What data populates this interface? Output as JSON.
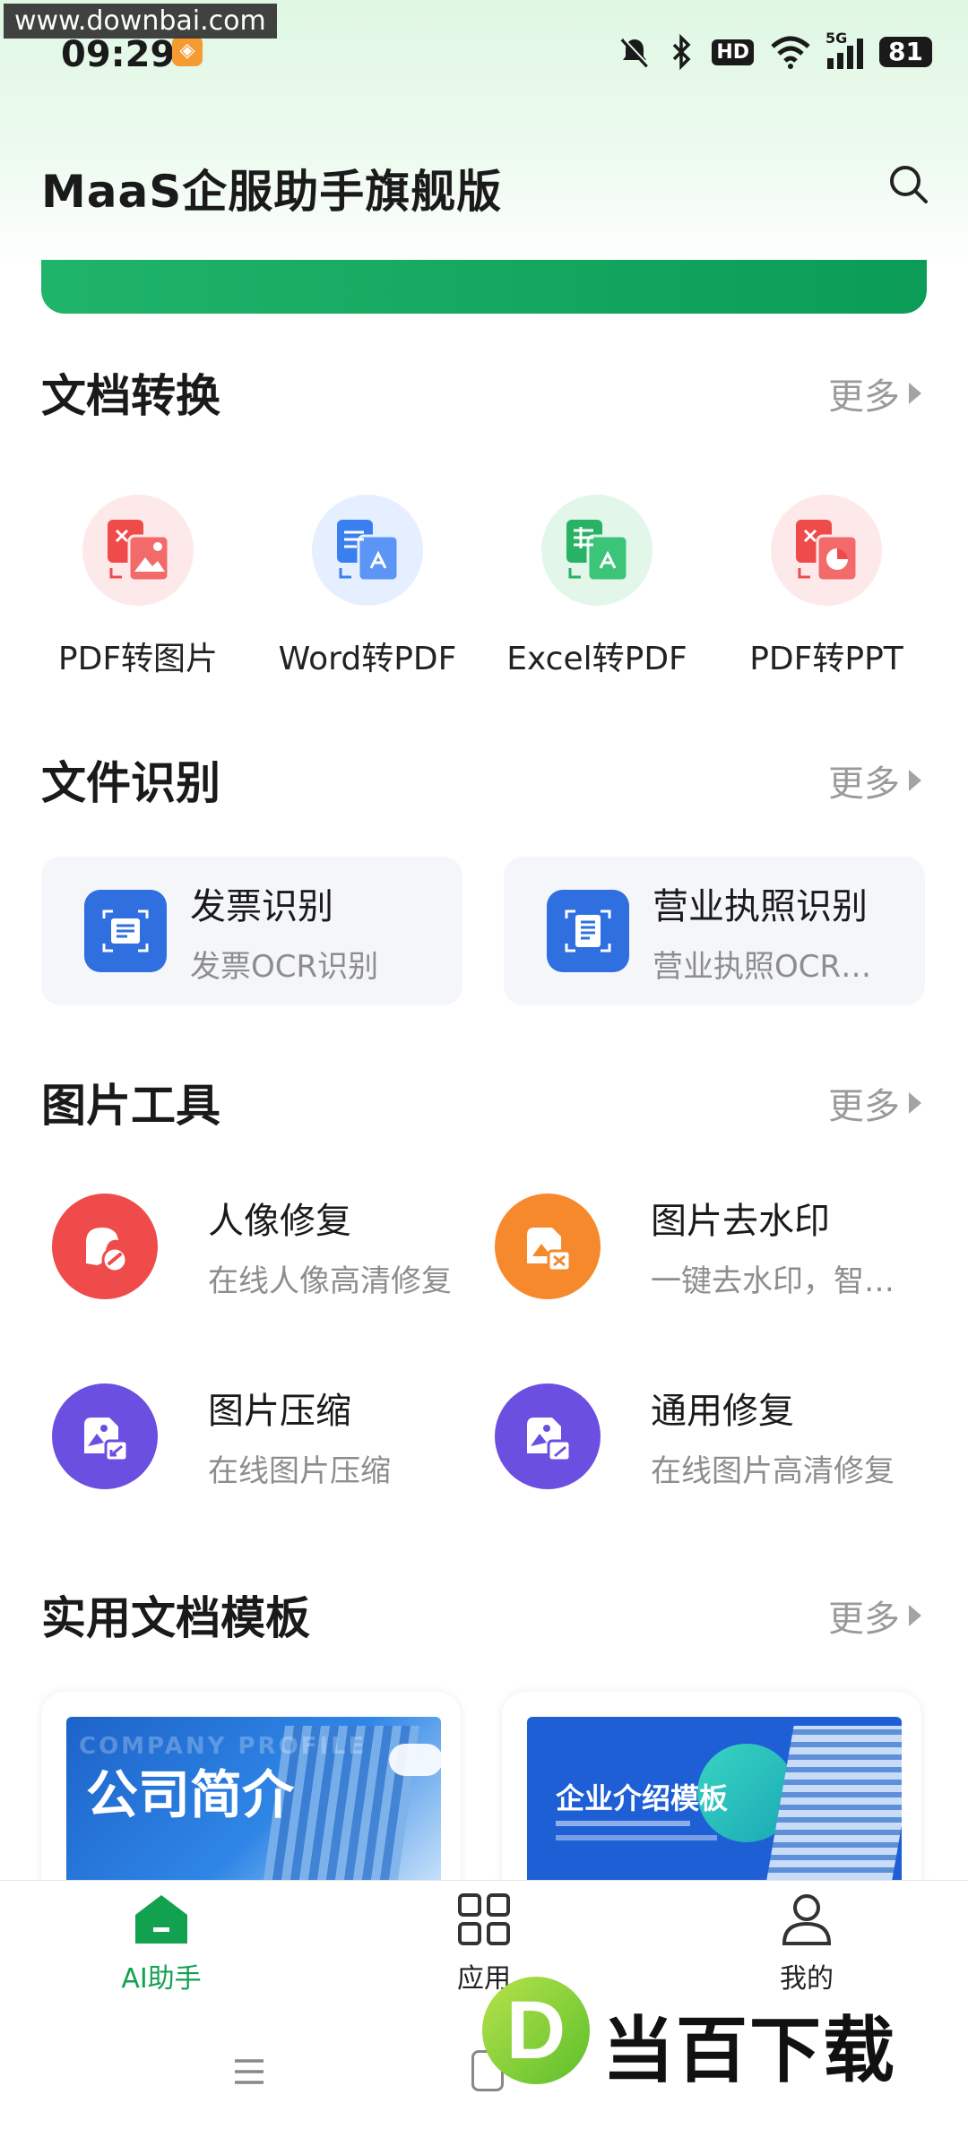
{
  "status_bar": {
    "watermark": "www.downbai.com",
    "time": "09:29",
    "battery": "81",
    "network": "5G",
    "hd": "HD"
  },
  "header": {
    "title": "MaaS企服助手旗舰版",
    "search_icon": "search-icon"
  },
  "sections": {
    "conversion": {
      "title": "文档转换",
      "more": "更多",
      "items": [
        {
          "label": "PDF转图片",
          "icon": "pdf-to-image-icon",
          "color": "#ef4b4b",
          "bg": "#fde9e9"
        },
        {
          "label": "Word转PDF",
          "icon": "word-to-pdf-icon",
          "color": "#3a7ff0",
          "bg": "#e6efff"
        },
        {
          "label": "Excel转PDF",
          "icon": "excel-to-pdf-icon",
          "color": "#27b264",
          "bg": "#e2f6ea"
        },
        {
          "label": "PDF转PPT",
          "icon": "pdf-to-ppt-icon",
          "color": "#ef4b4b",
          "bg": "#fde9e9"
        }
      ]
    },
    "recognition": {
      "title": "文件识别",
      "more": "更多",
      "items": [
        {
          "title": "发票识别",
          "subtitle": "发票OCR识别",
          "icon": "invoice-icon"
        },
        {
          "title": "营业执照识别",
          "subtitle": "营业执照OCR识...",
          "icon": "license-icon"
        }
      ]
    },
    "image_tools": {
      "title": "图片工具",
      "more": "更多",
      "items": [
        {
          "title": "人像修复",
          "subtitle": "在线人像高清修复",
          "icon": "portrait-repair-icon",
          "color": "#ef4b4b"
        },
        {
          "title": "图片去水印",
          "subtitle": "一键去水印，智能...",
          "icon": "remove-watermark-icon",
          "color": "#f6892c"
        },
        {
          "title": "图片压缩",
          "subtitle": "在线图片压缩",
          "icon": "image-compress-icon",
          "color": "#6a4fe0"
        },
        {
          "title": "通用修复",
          "subtitle": "在线图片高清修复",
          "icon": "general-repair-icon",
          "color": "#6a4fe0"
        }
      ]
    },
    "templates": {
      "title": "实用文档模板",
      "more": "更多",
      "items": [
        {
          "title": "公司简介",
          "overlay": "COMPANY PROFILE"
        },
        {
          "title": "企业介绍模板"
        }
      ]
    }
  },
  "tabbar": {
    "items": [
      {
        "label": "AI助手",
        "icon": "home-icon",
        "active": true
      },
      {
        "label": "应用",
        "icon": "grid-icon",
        "active": false
      },
      {
        "label": "我的",
        "icon": "user-icon",
        "active": false
      }
    ],
    "active_color": "#12a24f"
  },
  "bottom_overlay": {
    "logo_letter": "D",
    "logo_text": "当百下载"
  }
}
